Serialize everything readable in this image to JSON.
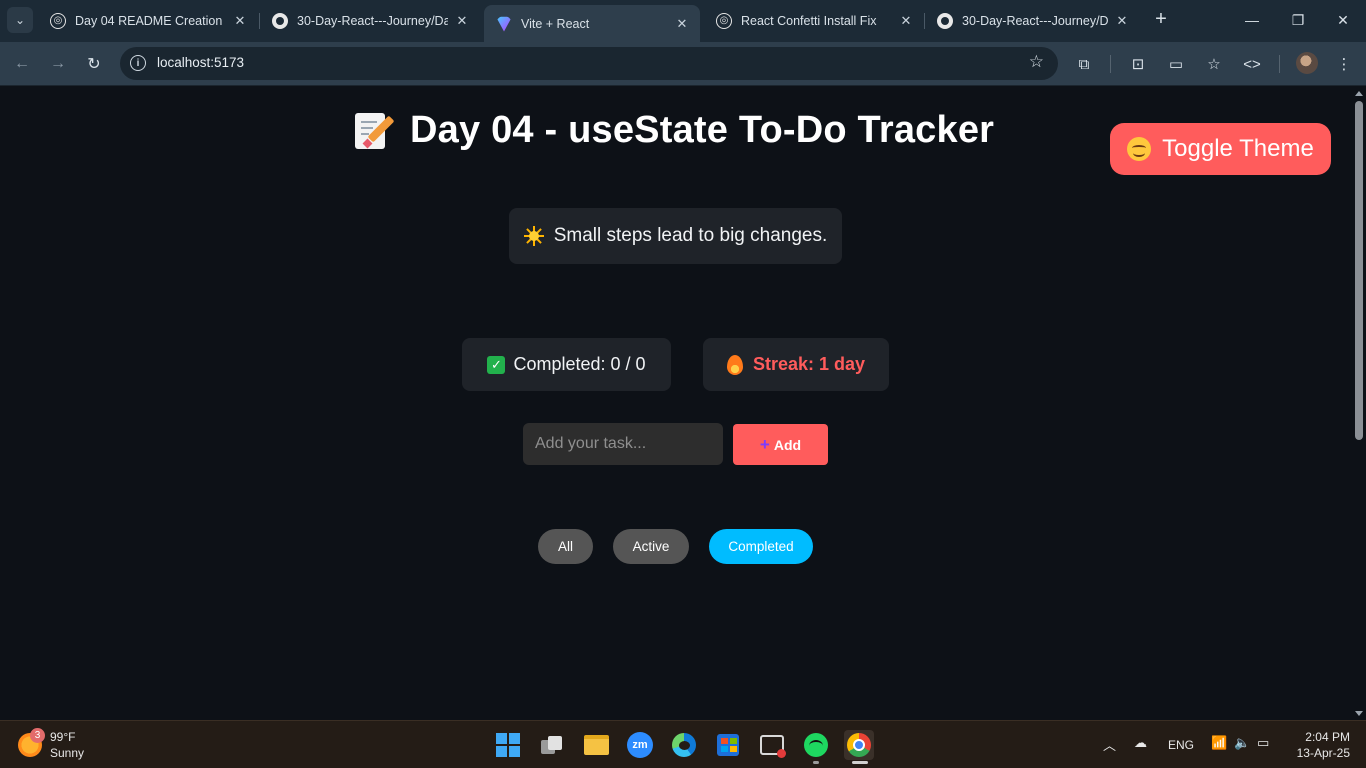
{
  "browser": {
    "tabs": [
      {
        "title": "Day 04 README Creation",
        "icon": "chatgpt-icon"
      },
      {
        "title": "30-Day-React---Journey/Day",
        "icon": "github-icon"
      },
      {
        "title": "Vite + React",
        "icon": "vite-icon",
        "active": true
      },
      {
        "title": "React Confetti Install Fix",
        "icon": "chatgpt-icon"
      },
      {
        "title": "30-Day-React---Journey/Day",
        "icon": "github-icon"
      }
    ],
    "url": "localhost:5173"
  },
  "app": {
    "title": "Day 04 - useState To-Do Tracker",
    "toggle_label": "Toggle Theme",
    "quote": "Small steps lead to big changes.",
    "completed_label": "Completed: 0 / 0",
    "streak_label": "Streak: 1 day",
    "input_placeholder": "Add your task...",
    "add_label": "Add",
    "filters": [
      "All",
      "Active",
      "Completed"
    ],
    "active_filter": "Completed",
    "colors": {
      "accent": "#ff5c5c",
      "filter_active": "#00bcff",
      "filter_inactive": "#555555",
      "background": "#0d1117",
      "card": "#1f2329"
    }
  },
  "taskbar": {
    "weather_temp": "99°F",
    "weather_desc": "Sunny",
    "weather_badge": "3",
    "lang": "ENG",
    "time": "2:04 PM",
    "date": "13-Apr-25"
  }
}
